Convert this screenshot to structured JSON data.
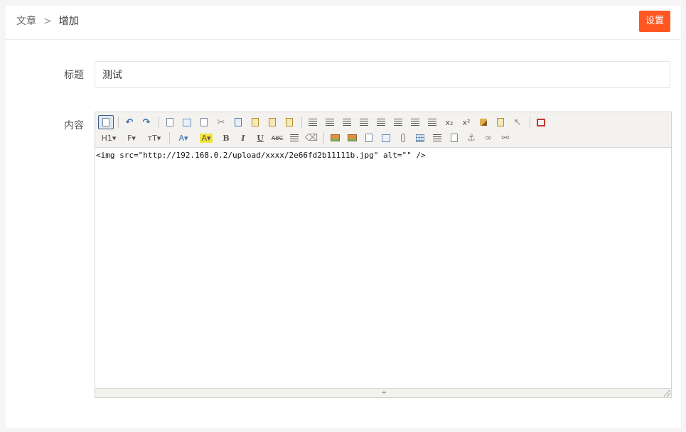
{
  "breadcrumb": {
    "root": "文章",
    "separator": ">",
    "current": "增加"
  },
  "header": {
    "settings_label": "设置"
  },
  "form": {
    "title_label": "标题",
    "title_value": "测试",
    "content_label": "内容"
  },
  "editor": {
    "content": "<img src=\"http://192.168.0.2/upload/xxxx/2e66fd2b11111b.jpg\" alt=\"\" />",
    "toolbar_row1": [
      {
        "name": "source-icon",
        "glyph": ""
      },
      {
        "name": "undo-icon",
        "glyph": "↶"
      },
      {
        "name": "redo-icon",
        "glyph": "↷"
      },
      {
        "name": "preview-icon",
        "glyph": ""
      },
      {
        "name": "print-icon",
        "glyph": ""
      },
      {
        "name": "template-icon",
        "glyph": ""
      },
      {
        "name": "cut-icon",
        "glyph": "✂"
      },
      {
        "name": "copy-icon",
        "glyph": ""
      },
      {
        "name": "paste-icon",
        "glyph": ""
      },
      {
        "name": "paste-text-icon",
        "glyph": ""
      },
      {
        "name": "paste-word-icon",
        "glyph": ""
      },
      {
        "name": "align-left-icon",
        "glyph": ""
      },
      {
        "name": "align-center-icon",
        "glyph": ""
      },
      {
        "name": "align-right-icon",
        "glyph": ""
      },
      {
        "name": "justify-icon",
        "glyph": ""
      },
      {
        "name": "ordered-list-icon",
        "glyph": ""
      },
      {
        "name": "unordered-list-icon",
        "glyph": ""
      },
      {
        "name": "indent-icon",
        "glyph": ""
      },
      {
        "name": "outdent-icon",
        "glyph": ""
      },
      {
        "name": "subscript-icon",
        "glyph": "x₂"
      },
      {
        "name": "superscript-icon",
        "glyph": "x²"
      },
      {
        "name": "clear-format-icon",
        "glyph": ""
      },
      {
        "name": "quick-format-icon",
        "glyph": ""
      },
      {
        "name": "select-all-icon",
        "glyph": "↖"
      },
      {
        "name": "fullscreen-icon",
        "glyph": ""
      }
    ],
    "toolbar_row2": [
      {
        "name": "heading-icon",
        "glyph": "H1▾"
      },
      {
        "name": "font-family-icon",
        "glyph": "𝓕▾"
      },
      {
        "name": "font-size-icon",
        "glyph": "тT▾"
      },
      {
        "name": "font-color-icon",
        "glyph": "A▾"
      },
      {
        "name": "highlight-icon",
        "glyph": "A▾"
      },
      {
        "name": "bold-icon",
        "glyph": "B"
      },
      {
        "name": "italic-icon",
        "glyph": "I"
      },
      {
        "name": "underline-icon",
        "glyph": "U"
      },
      {
        "name": "strikethrough-icon",
        "glyph": "ABC"
      },
      {
        "name": "line-height-icon",
        "glyph": "↕"
      },
      {
        "name": "eraser-icon",
        "glyph": "⌫"
      },
      {
        "name": "image-icon",
        "glyph": ""
      },
      {
        "name": "multi-image-icon",
        "glyph": ""
      },
      {
        "name": "flash-icon",
        "glyph": ""
      },
      {
        "name": "media-icon",
        "glyph": ""
      },
      {
        "name": "attachment-icon",
        "glyph": ""
      },
      {
        "name": "table-icon",
        "glyph": ""
      },
      {
        "name": "horizontal-rule-icon",
        "glyph": ""
      },
      {
        "name": "page-break-icon",
        "glyph": ""
      },
      {
        "name": "anchor-icon",
        "glyph": "⚓"
      },
      {
        "name": "link-icon",
        "glyph": "∞"
      },
      {
        "name": "unlink-icon",
        "glyph": "⚯"
      }
    ]
  }
}
